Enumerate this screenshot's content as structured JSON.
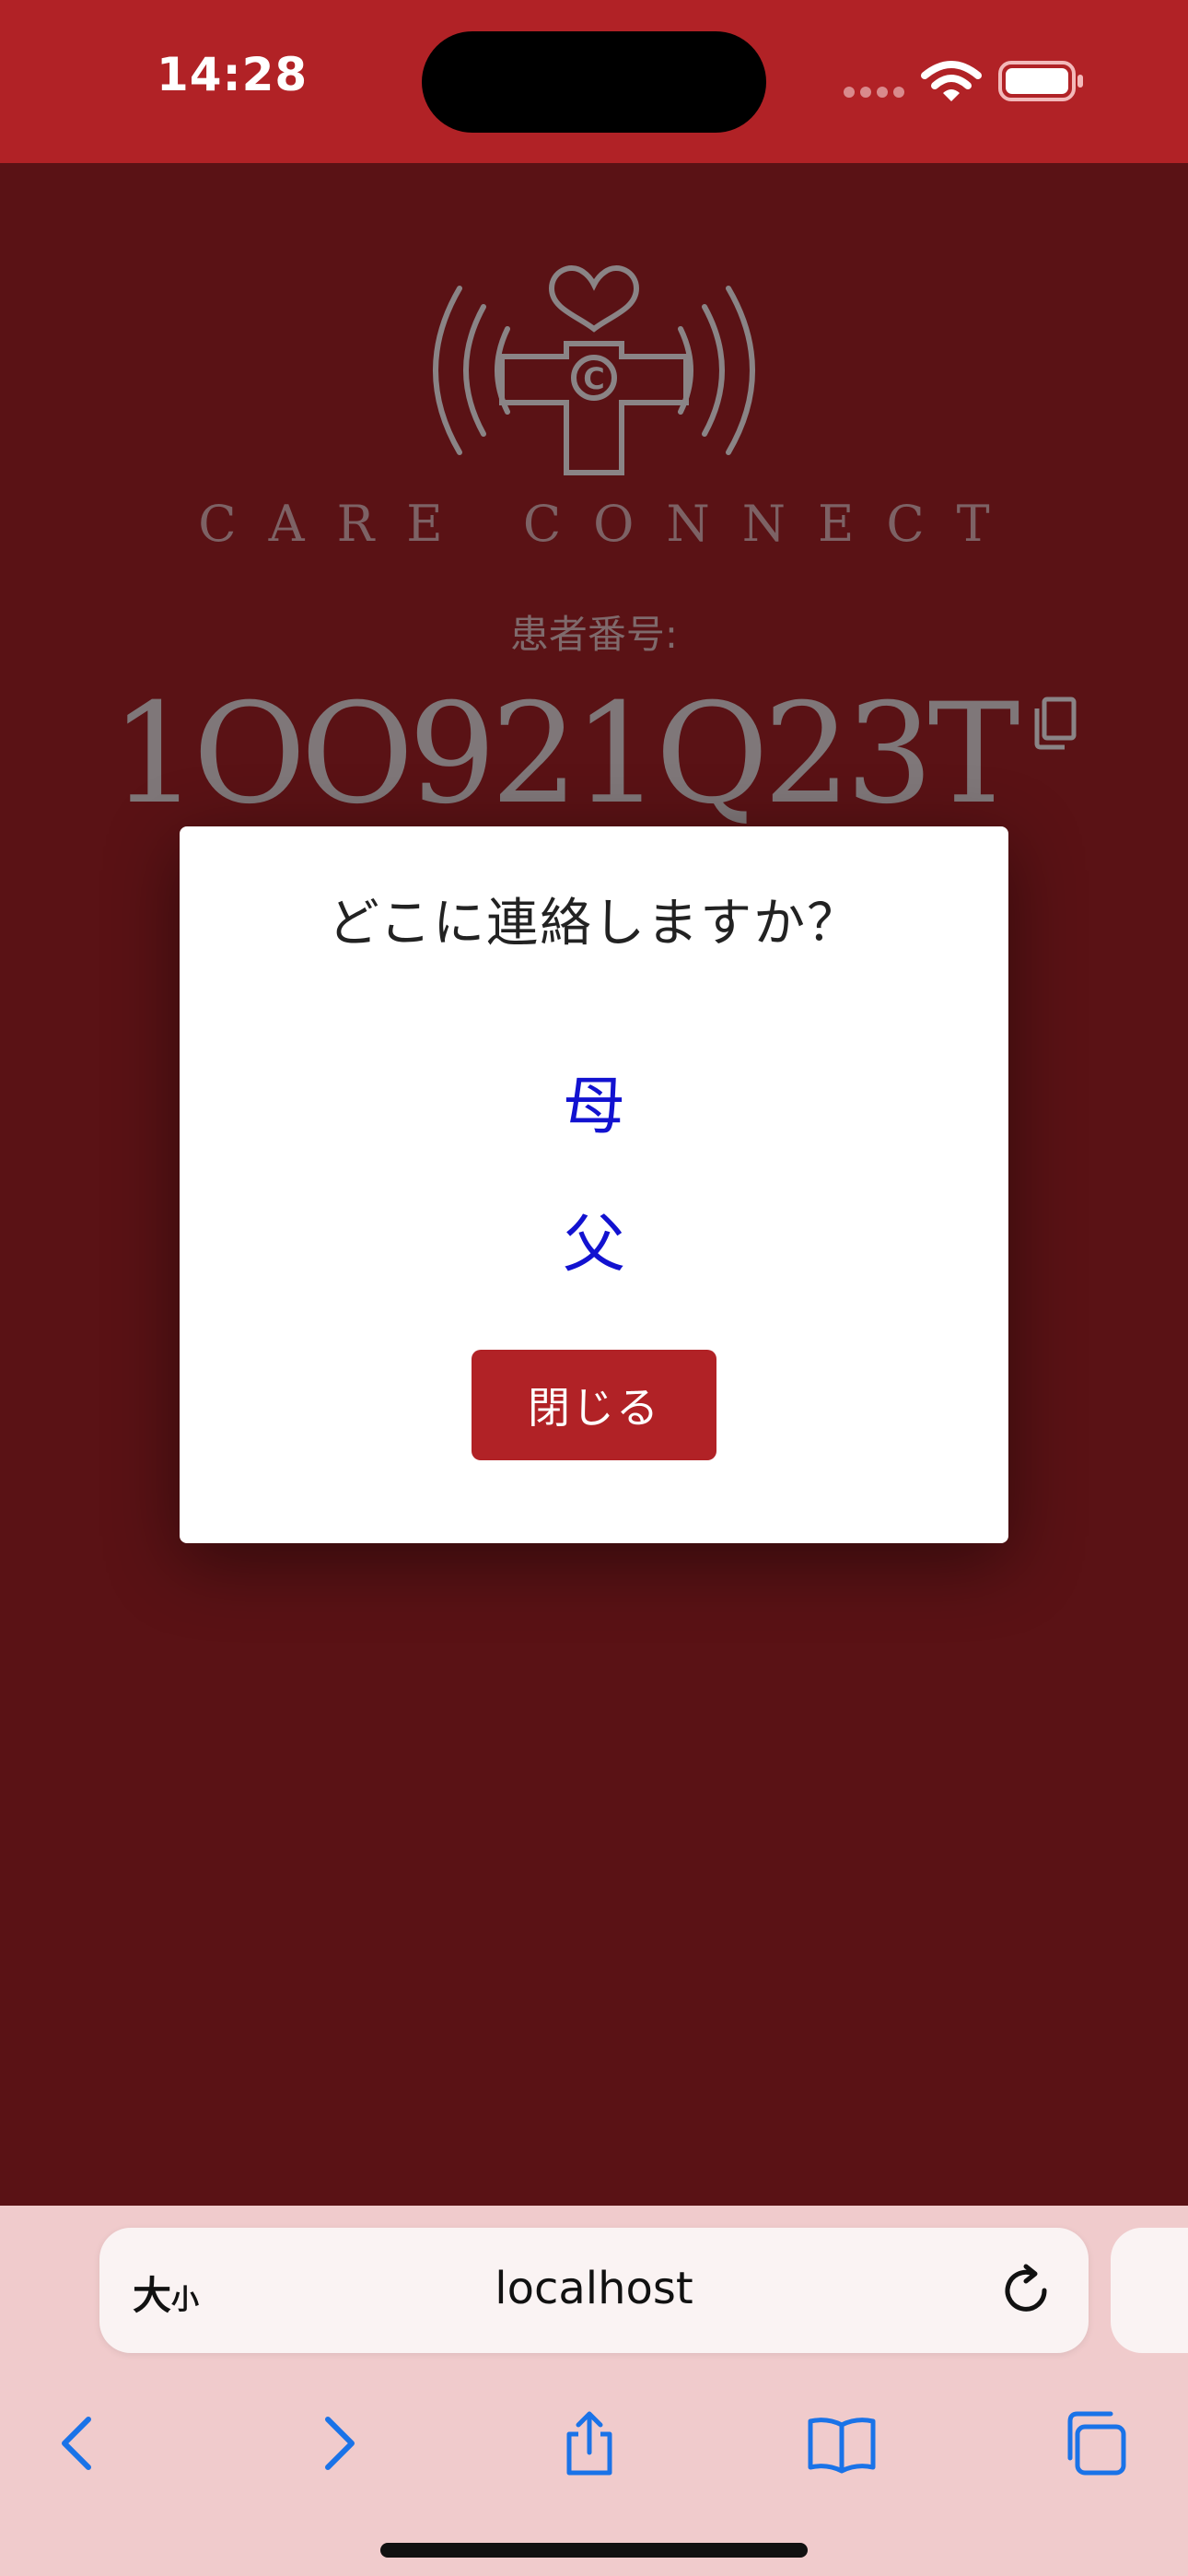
{
  "status_bar": {
    "time": "14:28"
  },
  "brand": {
    "name": "CARE CONNECT",
    "logo_letter": "C"
  },
  "patient": {
    "label": "患者番号:",
    "number": "1OO921Q23T"
  },
  "modal": {
    "title": "どこに連絡しますか？",
    "options": [
      {
        "label": "母"
      },
      {
        "label": "父"
      }
    ],
    "close_label": "閉じる"
  },
  "browser": {
    "text_size_big": "大",
    "text_size_small": "小",
    "url": "localhost"
  },
  "colors": {
    "accent": "#b12226",
    "overlay_background": "#5a1215",
    "option_link": "#1212d0",
    "toolbar_background": "#f0cbcc",
    "toolbar_icon": "#1a73e8"
  },
  "icons": {
    "copy": "copy-icon",
    "reload": "reload-icon",
    "back": "chevron-left-icon",
    "forward": "chevron-right-icon",
    "share": "share-icon",
    "bookmarks": "book-icon",
    "tabs": "tabs-icon"
  }
}
